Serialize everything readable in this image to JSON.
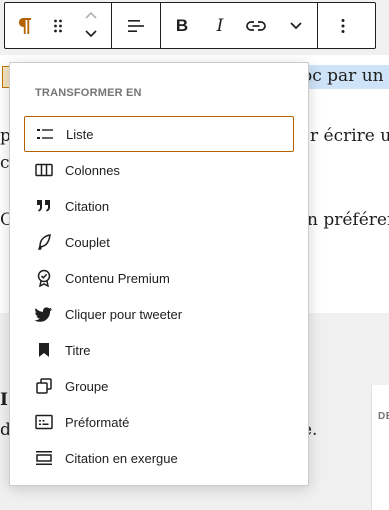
{
  "editor": {
    "line_selected_end": "oc par un a",
    "line_p_start": "p",
    "line_p_end": "r écrire un",
    "line_c_start": "c",
    "line_o_start": "C",
    "line_o_end": "n préférera",
    "line_heading_start": "I",
    "line_d_start": "d",
    "line_d_end": "e.",
    "right_panel_label": "DE"
  },
  "toolbar": {
    "paragraph_icon": "paragraph-icon",
    "drag_icon": "drag-handle-icon",
    "move_up_icon": "chevron-up-icon",
    "move_down_icon": "chevron-down-icon",
    "align_icon": "align-left-icon",
    "bold_label": "B",
    "italic_label": "I",
    "link_icon": "link-icon",
    "more_formats_icon": "chevron-down-icon",
    "options_icon": "more-vertical-icon"
  },
  "transform_menu": {
    "heading": "TRANSFORMER EN",
    "items": [
      {
        "label": "Liste",
        "icon": "list-icon",
        "active": true
      },
      {
        "label": "Colonnes",
        "icon": "columns-icon"
      },
      {
        "label": "Citation",
        "icon": "quote-icon"
      },
      {
        "label": "Couplet",
        "icon": "feather-icon"
      },
      {
        "label": "Contenu Premium",
        "icon": "premium-badge-icon"
      },
      {
        "label": "Cliquer pour tweeter",
        "icon": "twitter-icon"
      },
      {
        "label": "Titre",
        "icon": "bookmark-icon"
      },
      {
        "label": "Groupe",
        "icon": "group-icon"
      },
      {
        "label": "Préformaté",
        "icon": "preformatted-icon"
      },
      {
        "label": "Citation en exergue",
        "icon": "pullquote-icon"
      }
    ]
  },
  "colors": {
    "accent": "#b26200",
    "selection": "#cfe3f8",
    "text": "#1e1e1e",
    "muted": "#757575"
  }
}
